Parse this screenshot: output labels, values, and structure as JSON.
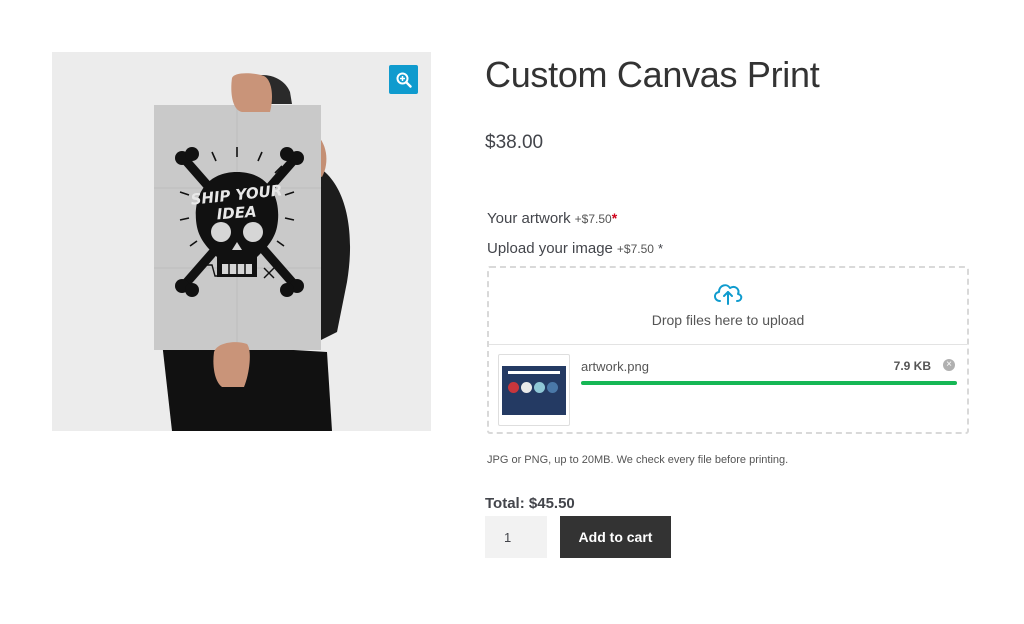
{
  "product": {
    "title": "Custom Canvas Print",
    "price": "$38.00",
    "poster_image_alt": "Person holding SHIP YOUR IDEA poster",
    "zoom_icon": "magnifier-plus-icon"
  },
  "fields": {
    "artwork": {
      "label": "Your artwork",
      "fee": "+$7.50",
      "required": "*"
    },
    "upload": {
      "label": "Upload your image",
      "fee": "+$7.50",
      "required": "*"
    }
  },
  "dropzone": {
    "icon": "cloud-upload-icon",
    "text": "Drop files here to upload",
    "file": {
      "name": "artwork.png",
      "size": "7.9 KB",
      "progress": 1.0,
      "remove_icon": "close-circle-icon"
    }
  },
  "help_text": "JPG or PNG, up to 20MB. We check every file before printing.",
  "total": "Total: $45.50",
  "quantity": "1",
  "add_to_cart": "Add to cart",
  "colors": {
    "accent": "#0f9bce",
    "progress": "#16b755",
    "button": "#333333",
    "required": "#d0021b"
  }
}
